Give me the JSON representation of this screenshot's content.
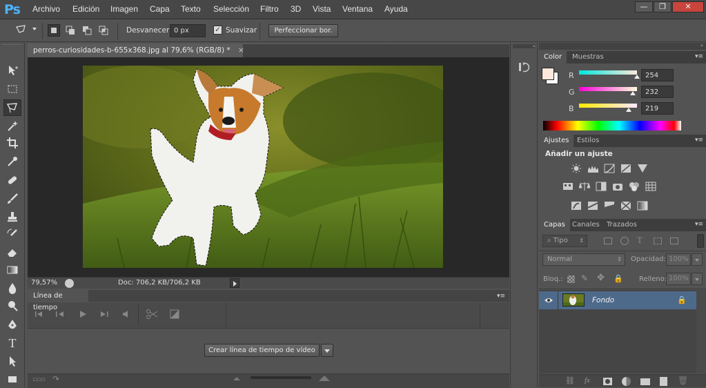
{
  "app": {
    "logo": "Ps"
  },
  "menu": [
    "Archivo",
    "Edición",
    "Imagen",
    "Capa",
    "Texto",
    "Selección",
    "Filtro",
    "3D",
    "Vista",
    "Ventana",
    "Ayuda"
  ],
  "window_controls": {
    "minimize": "—",
    "restore": "❐",
    "close": "✕"
  },
  "options": {
    "feather_label": "Desvanecer:",
    "feather_value": "0 px",
    "antialias_label": "Suavizar",
    "antialias_checked": true,
    "refine_button": "Perfeccionar bor."
  },
  "tools": [
    "move-tool-icon",
    "marquee-tool-icon",
    "polygonal-lasso-tool-icon",
    "magic-wand-tool-icon",
    "crop-tool-icon",
    "eyedropper-tool-icon",
    "healing-brush-tool-icon",
    "brush-tool-icon",
    "clone-stamp-tool-icon",
    "history-brush-tool-icon",
    "eraser-tool-icon",
    "gradient-tool-icon",
    "blur-tool-icon",
    "dodge-tool-icon",
    "pen-tool-icon",
    "type-tool-icon",
    "path-selection-tool-icon",
    "shape-tool-icon"
  ],
  "document": {
    "tab_title": "perros-curiosidades-b-655x368.jpg al 79,6% (RGB/8) *",
    "tab_close": "×",
    "zoom": "79,57%",
    "doc_info": "Doc: 706,2 KB/706,2 KB"
  },
  "timeline": {
    "title": "Línea de tiempo",
    "create_button": "Crear línea de tiempo de vídeo"
  },
  "color_panel": {
    "tabs": [
      "Color",
      "Muestras"
    ],
    "r_label": "R",
    "r_value": "254",
    "g_label": "G",
    "g_value": "232",
    "b_label": "B",
    "b_value": "219",
    "foreground": "#fee8db",
    "background": "#ffffff"
  },
  "adjustments_panel": {
    "tabs": [
      "Ajustes",
      "Estilos"
    ],
    "title": "Añadir un ajuste"
  },
  "layers_panel": {
    "tabs": [
      "Capas",
      "Canales",
      "Trazados"
    ],
    "filter_label": "Tipo",
    "blend_mode": "Normal",
    "opacity_label": "Opacidad:",
    "opacity_value": "100%",
    "lock_label": "Bloq.:",
    "fill_label": "Relleno:",
    "fill_value": "100%",
    "layers": [
      {
        "name": "Fondo",
        "visible": true,
        "locked": true
      }
    ]
  }
}
